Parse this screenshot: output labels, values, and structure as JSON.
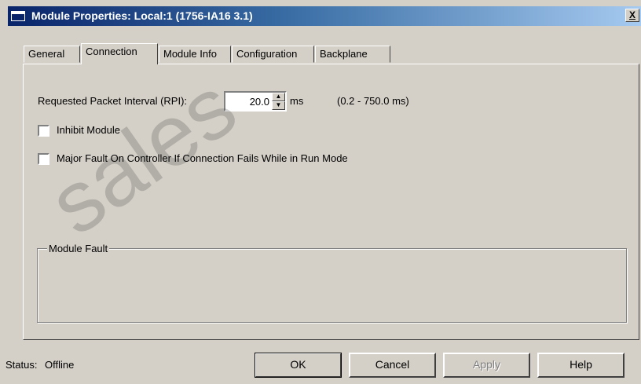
{
  "window": {
    "title": "Module Properties: Local:1 (1756-IA16 3.1)",
    "close_label": "X"
  },
  "watermark": {
    "text": "sales"
  },
  "tabs": [
    {
      "label": "General",
      "active": false
    },
    {
      "label": "Connection",
      "active": true
    },
    {
      "label": "Module Info",
      "active": false
    },
    {
      "label": "Configuration",
      "active": false
    },
    {
      "label": "Backplane",
      "active": false
    }
  ],
  "connection": {
    "rpi_label": "Requested Packet Interval (RPI):",
    "rpi_value": "20.0",
    "rpi_units": "ms",
    "rpi_range": "(0.2 - 750.0 ms)",
    "inhibit_label": "Inhibit Module",
    "inhibit_checked": false,
    "major_fault_label": "Major Fault On Controller If Connection Fails While in Run Mode",
    "major_fault_checked": false,
    "module_fault_title": "Module Fault"
  },
  "footer": {
    "status_label": "Status:",
    "status_value": "Offline",
    "ok_label": "OK",
    "cancel_label": "Cancel",
    "apply_label": "Apply",
    "help_label": "Help"
  }
}
